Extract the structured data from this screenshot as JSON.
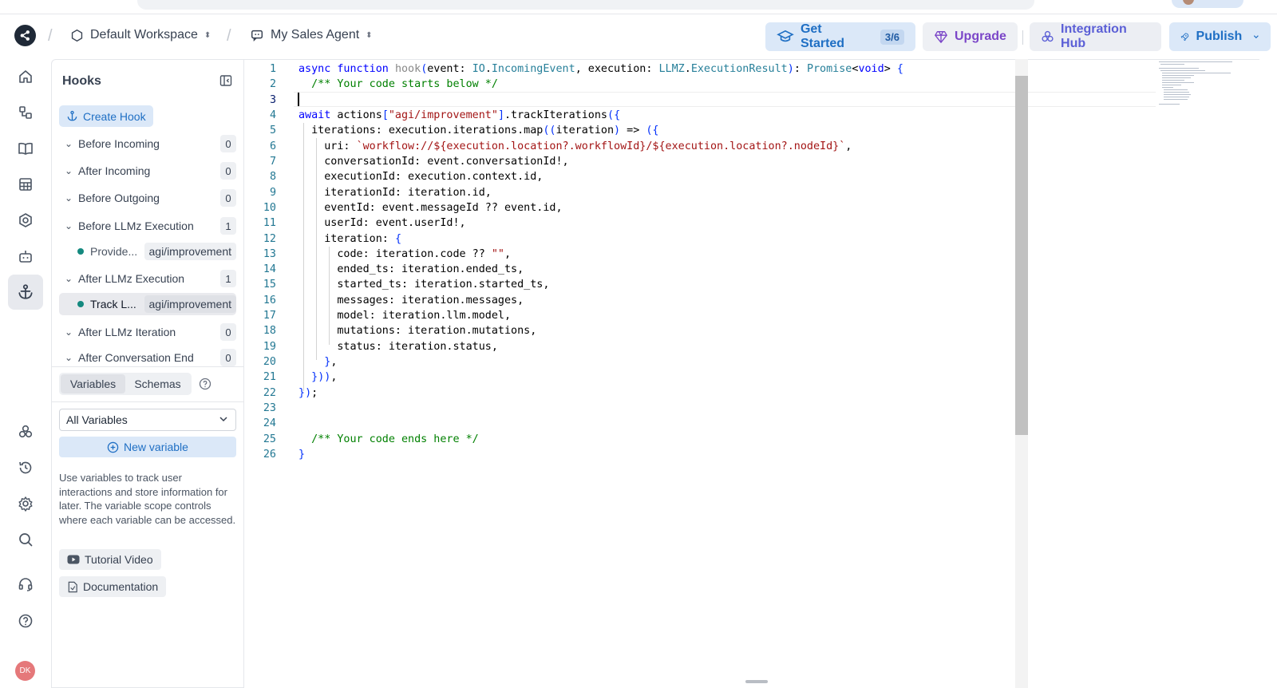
{
  "header": {
    "workspace": "Default Workspace",
    "agent": "My Sales Agent",
    "get_started": "Get Started",
    "get_started_progress": "3/6",
    "upgrade": "Upgrade",
    "integration_hub": "Integration Hub",
    "publish": "Publish"
  },
  "rail": {
    "items": [
      "home-icon",
      "flow-icon",
      "book-icon",
      "table-icon",
      "hexagon-settings-icon",
      "bot-icon",
      "anchor-icon",
      "integrations-icon",
      "history-icon",
      "gear-icon",
      "search-icon",
      "headset-icon",
      "help-icon"
    ],
    "active": "anchor-icon",
    "avatar_initials": "DK"
  },
  "hooks_panel": {
    "title": "Hooks",
    "create_button": "Create Hook",
    "groups": [
      {
        "label": "Before Incoming",
        "count": "0"
      },
      {
        "label": "After Incoming",
        "count": "0"
      },
      {
        "label": "Before Outgoing",
        "count": "0"
      },
      {
        "label": "Before LLMz Execution",
        "count": "1"
      },
      {
        "label": "After LLMz Execution",
        "count": "1"
      },
      {
        "label": "After LLMz Iteration",
        "count": "0"
      },
      {
        "label": "After Conversation End",
        "count": "0"
      }
    ],
    "children": [
      {
        "name": "Provide...",
        "tag": "agi/improvement"
      },
      {
        "name": "Track L...",
        "tag": "agi/improvement"
      }
    ]
  },
  "variables_panel": {
    "tabs": [
      "Variables",
      "Schemas"
    ],
    "filter_value": "All Variables",
    "new_variable": "New variable",
    "help_text": "Use variables to track user interactions and store information for later. The variable scope controls where each variable can be accessed.",
    "tutorial_video": "Tutorial Video",
    "documentation": "Documentation"
  },
  "editor": {
    "line_numbers": [
      "1",
      "2",
      "3",
      "4",
      "5",
      "6",
      "7",
      "8",
      "9",
      "10",
      "11",
      "12",
      "13",
      "14",
      "15",
      "16",
      "17",
      "18",
      "19",
      "20",
      "21",
      "22",
      "23",
      "24",
      "25",
      "26"
    ],
    "lines": [
      "async function hook(event: IO.IncomingEvent, execution: LLMZ.ExecutionResult): Promise<void> {",
      "  /** Your code starts below */",
      "",
      "await actions[\"agi/improvement\"].trackIterations({",
      "  iterations: execution.iterations.map((iteration) => ({",
      "    uri: `workflow://${execution.location?.workflowId}/${execution.location?.nodeId}`,",
      "    conversationId: event.conversationId!,",
      "    executionId: execution.context.id,",
      "    iterationId: iteration.id,",
      "    eventId: event.messageId ?? event.id,",
      "    userId: event.userId!,",
      "    iteration: {",
      "      code: iteration.code ?? \"\",",
      "      ended_ts: iteration.ended_ts,",
      "      started_ts: iteration.started_ts,",
      "      messages: iteration.messages,",
      "      model: iteration.llm.model,",
      "      mutations: iteration.mutations,",
      "      status: iteration.status,",
      "    },",
      "  })),",
      "});",
      "",
      "",
      "  /** Your code ends here */",
      "}"
    ],
    "current_line": "3"
  },
  "colors": {
    "accent_blue": "#1f6fc4",
    "upgrade_purple": "#7b46c8",
    "hook_dot": "#14897f"
  }
}
